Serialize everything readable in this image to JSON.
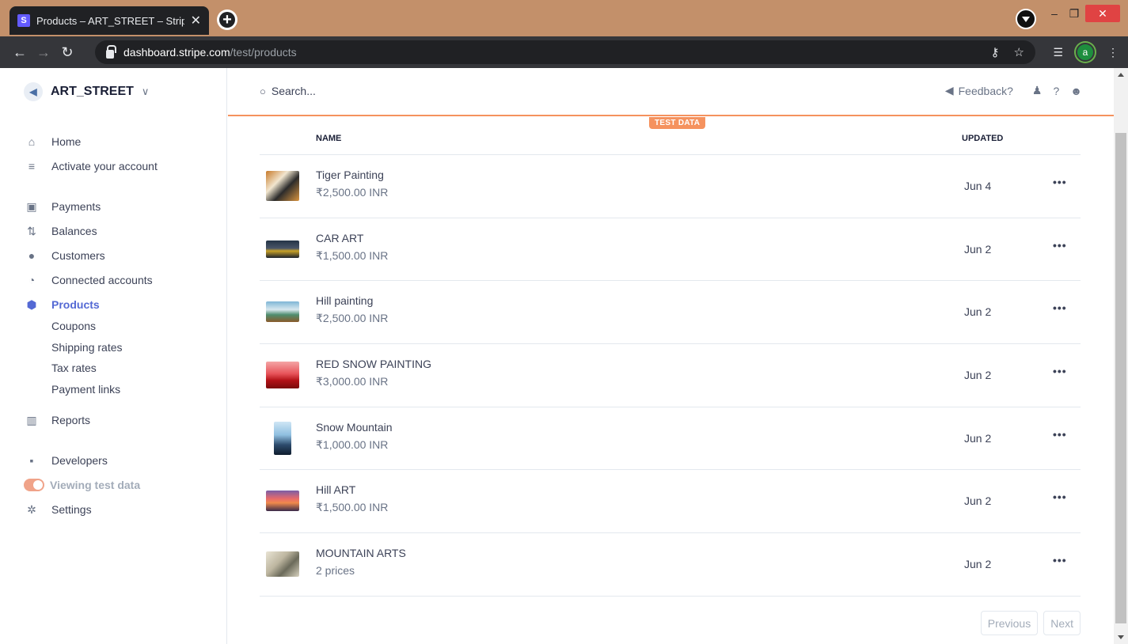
{
  "browser": {
    "tab_title": "Products – ART_STREET – Stripe [",
    "tab_favicon": "S",
    "tab_close": "✕",
    "new_tab": "+",
    "url_host": "dashboard.stripe.com",
    "url_path": "/test/products",
    "profile_initial": "a",
    "window_min": "–",
    "window_max": "❐",
    "window_close": "✕"
  },
  "sidebar": {
    "account_name": "ART_STREET",
    "account_chevron": "∨",
    "items": [
      {
        "label": "Home",
        "icon": "home-icon"
      },
      {
        "label": "Activate your account",
        "icon": "activate-icon"
      },
      {
        "label": "Payments",
        "icon": "payments-icon"
      },
      {
        "label": "Balances",
        "icon": "balances-icon"
      },
      {
        "label": "Customers",
        "icon": "customers-icon"
      },
      {
        "label": "Connected accounts",
        "icon": "connected-accounts-icon"
      },
      {
        "label": "Products",
        "icon": "products-icon",
        "active": true
      },
      {
        "label": "Reports",
        "icon": "reports-icon"
      },
      {
        "label": "Developers",
        "icon": "developers-icon"
      },
      {
        "label": "Viewing test data",
        "icon": "test-data-toggle"
      },
      {
        "label": "Settings",
        "icon": "settings-icon"
      }
    ],
    "sub_items": [
      {
        "label": "Coupons"
      },
      {
        "label": "Shipping rates"
      },
      {
        "label": "Tax rates"
      },
      {
        "label": "Payment links"
      }
    ]
  },
  "topbar": {
    "search_placeholder": "Search...",
    "feedback_label": "Feedback?"
  },
  "test_badge": "TEST DATA",
  "table": {
    "columns": {
      "name": "NAME",
      "updated": "UPDATED"
    },
    "rows": [
      {
        "name": "Tiger Painting",
        "price": "₹2,500.00 INR",
        "updated": "Jun 4",
        "more": "•••"
      },
      {
        "name": "CAR ART",
        "price": "₹1,500.00 INR",
        "updated": "Jun 2",
        "more": "•••"
      },
      {
        "name": "Hill painting",
        "price": "₹2,500.00 INR",
        "updated": "Jun 2",
        "more": "•••"
      },
      {
        "name": "RED SNOW PAINTING",
        "price": "₹3,000.00 INR",
        "updated": "Jun 2",
        "more": "•••"
      },
      {
        "name": "Snow Mountain",
        "price": "₹1,000.00 INR",
        "updated": "Jun 2",
        "more": "•••"
      },
      {
        "name": "Hill ART",
        "price": "₹1,500.00 INR",
        "updated": "Jun 2",
        "more": "•••"
      },
      {
        "name": "MOUNTAIN ARTS",
        "price": "2 prices",
        "updated": "Jun 2",
        "more": "•••"
      }
    ]
  },
  "pagination": {
    "previous": "Previous",
    "next": "Next"
  },
  "colors": {
    "accent": "#5469d4",
    "test_orange": "#f5925e",
    "tab_bar": "#c3906a"
  }
}
